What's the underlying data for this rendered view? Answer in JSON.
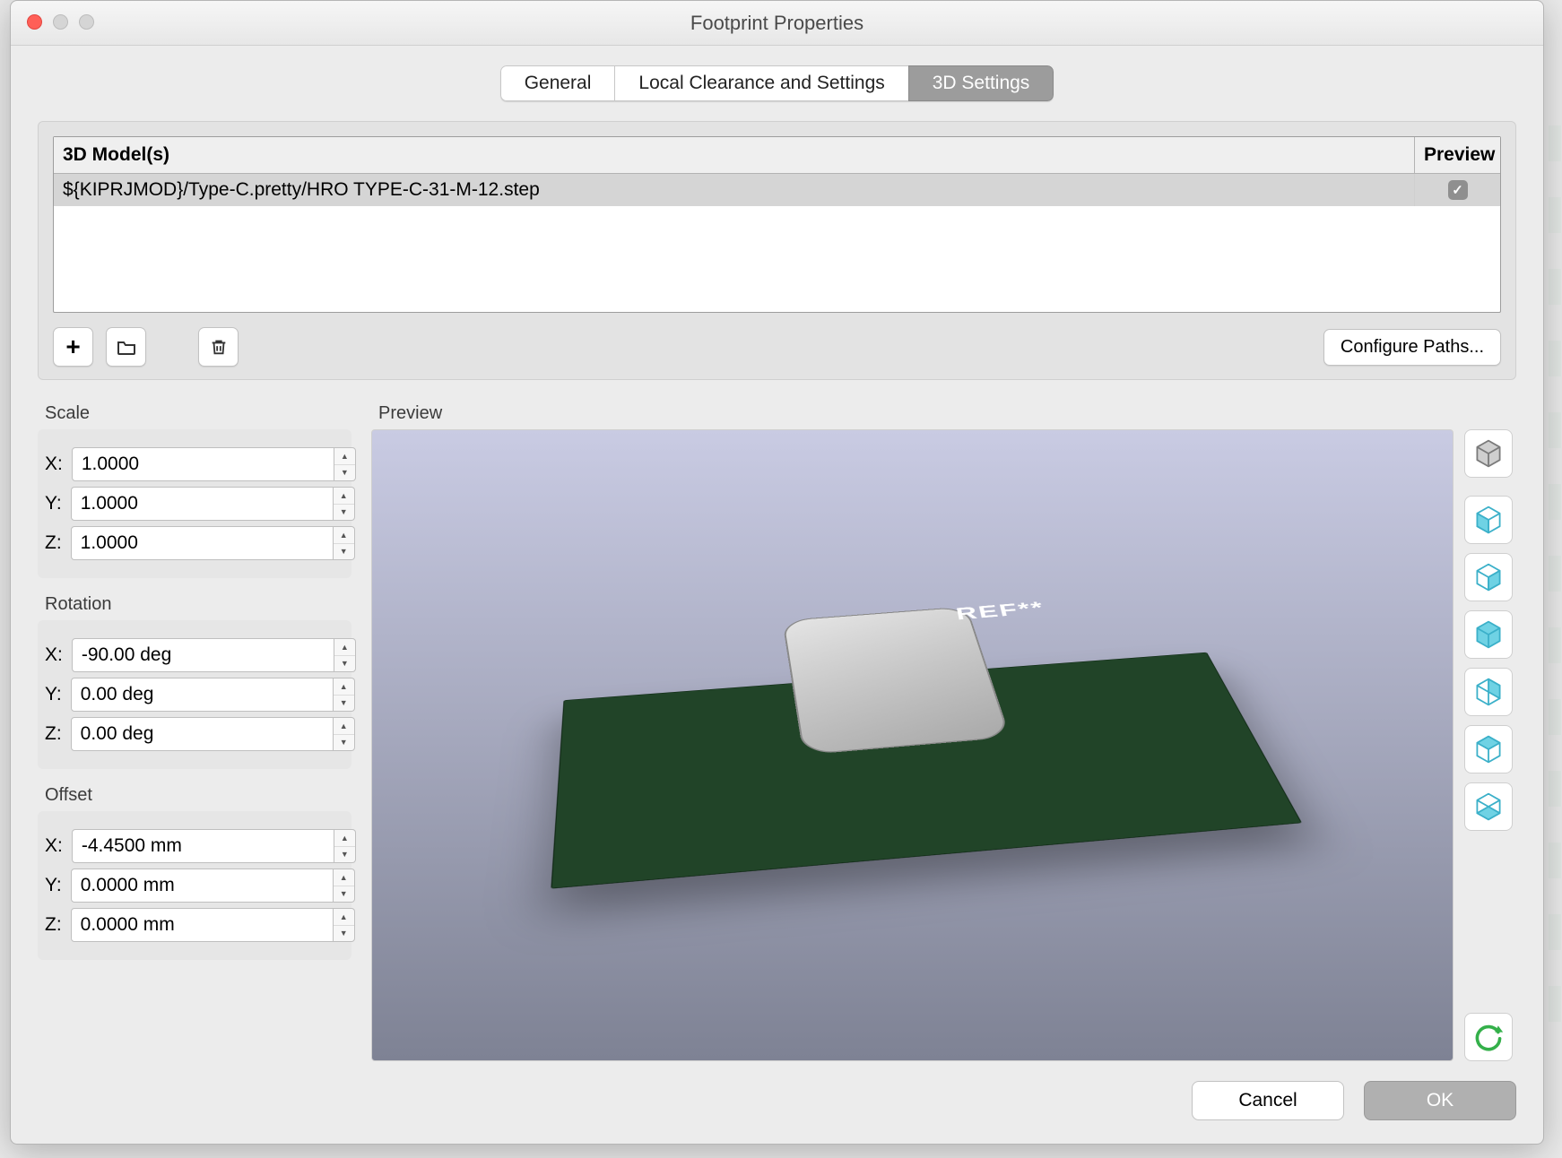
{
  "window": {
    "title": "Footprint Properties"
  },
  "tabs": {
    "general": "General",
    "local": "Local Clearance and Settings",
    "threed": "3D Settings",
    "active": "threed"
  },
  "models": {
    "headerPath": "3D Model(s)",
    "headerPreview": "Preview",
    "row0": {
      "path": "${KIPRJMOD}/Type-C.pretty/HRO  TYPE-C-31-M-12.step",
      "previewChecked": true
    }
  },
  "buttons": {
    "configurePaths": "Configure Paths...",
    "cancel": "Cancel",
    "ok": "OK"
  },
  "scale": {
    "label": "Scale",
    "x": "1.0000",
    "y": "1.0000",
    "z": "1.0000"
  },
  "rotation": {
    "label": "Rotation",
    "x": "-90.00 deg",
    "y": "0.00 deg",
    "z": "0.00 deg"
  },
  "offset": {
    "label": "Offset",
    "x": "-4.4500 mm",
    "y": "0.0000 mm",
    "z": "0.0000 mm"
  },
  "preview": {
    "label": "Preview",
    "refText": "REF**"
  },
  "axisLabels": {
    "x": "X:",
    "y": "Y:",
    "z": "Z:"
  },
  "icons": {
    "plus": "+",
    "check": "✓"
  }
}
